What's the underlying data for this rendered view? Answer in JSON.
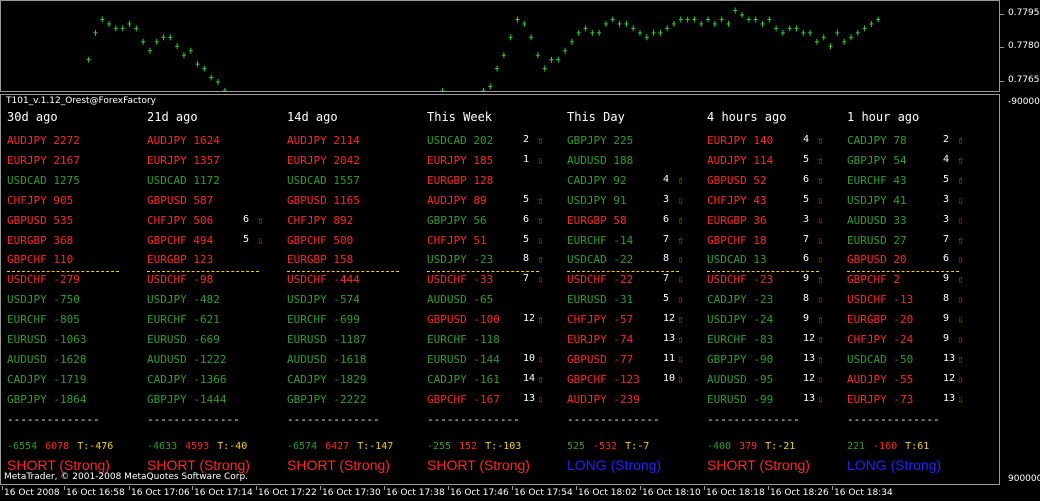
{
  "colors": {
    "short": "#ff2626",
    "long": "#2e9e2e",
    "separator": "#f2d400",
    "long_verdict": "#2020ff",
    "candle": "#2bd02b"
  },
  "price_axis": [
    "0.7795",
    "0.7780",
    "0.7765"
  ],
  "indicator_axis": [
    "-900000",
    "9000000"
  ],
  "indicator_title": "T101_v.1.12_Orest@ForexFactory",
  "footer": "MetaTrader, © 2001-2008 MetaQuotes Software Corp.",
  "time_axis": [
    "16 Oct 2008",
    "16 Oct 16:58",
    "16 Oct 17:06",
    "16 Oct 17:14",
    "16 Oct 17:22",
    "16 Oct 17:30",
    "16 Oct 17:38",
    "16 Oct 17:46",
    "16 Oct 17:54",
    "16 Oct 18:02",
    "16 Oct 18:10",
    "16 Oct 18:18",
    "16 Oct 18:26",
    "16 Oct 18:34"
  ],
  "price_series": [
    0.77625,
    0.77645,
    0.7765,
    0.7767,
    0.7768,
    0.7767,
    0.7768,
    0.7768,
    0.777,
    0.7772,
    0.7774,
    0.7776,
    0.7785,
    0.7791,
    0.7794,
    0.7793,
    0.7792,
    0.7792,
    0.7793,
    0.7792,
    0.7789,
    0.7787,
    0.7789,
    0.779,
    0.779,
    0.7788,
    0.7786,
    0.7787,
    0.7784,
    0.7783,
    0.7781,
    0.778,
    0.7778,
    0.7776,
    0.7775,
    0.7774,
    0.7772,
    0.7773,
    0.7771,
    0.7772,
    0.7774,
    0.7775,
    0.7773,
    0.7772,
    0.7771,
    0.7772,
    0.7774,
    0.7776,
    0.7774,
    0.7772,
    0.777,
    0.777,
    0.777,
    0.777,
    0.7771,
    0.777,
    0.7769,
    0.7769,
    0.7769,
    0.7771,
    0.777,
    0.7771,
    0.7772,
    0.7775,
    0.7778,
    0.7776,
    0.7775,
    0.7774,
    0.7775,
    0.7777,
    0.7778,
    0.7779,
    0.7783,
    0.7786,
    0.779,
    0.7794,
    0.7793,
    0.779,
    0.7786,
    0.7783,
    0.7785,
    0.7785,
    0.7787,
    0.7789,
    0.7791,
    0.7792,
    0.7791,
    0.7791,
    0.7793,
    0.7794,
    0.7793,
    0.7793,
    0.7792,
    0.7791,
    0.779,
    0.7791,
    0.7791,
    0.7792,
    0.7793,
    0.7794,
    0.7794,
    0.7794,
    0.7793,
    0.7794,
    0.7793,
    0.7794,
    0.7793,
    0.7796,
    0.7795,
    0.7794,
    0.7794,
    0.7793,
    0.7794,
    0.7792,
    0.7791,
    0.7792,
    0.7792,
    0.7791,
    0.7791,
    0.7789,
    0.779,
    0.7788,
    0.7791,
    0.7789,
    0.779,
    0.7791,
    0.7792,
    0.7793,
    0.7794
  ],
  "columns": [
    {
      "header": "30d ago",
      "rows": [
        {
          "pair": "AUDJPY",
          "value": "2272",
          "color": "red",
          "rank": "",
          "dir": ""
        },
        {
          "pair": "EURJPY",
          "value": "2167",
          "color": "red",
          "rank": "",
          "dir": ""
        },
        {
          "pair": "USDCAD",
          "value": "1275",
          "color": "green",
          "rank": "",
          "dir": ""
        },
        {
          "pair": "CHFJPY",
          "value": "905",
          "color": "red",
          "rank": "",
          "dir": ""
        },
        {
          "pair": "GBPUSD",
          "value": "535",
          "color": "red",
          "rank": "",
          "dir": ""
        },
        {
          "pair": "EURGBP",
          "value": "368",
          "color": "red",
          "rank": "",
          "dir": ""
        },
        {
          "pair": "GBPCHF",
          "value": "110",
          "color": "red",
          "rank": "",
          "dir": ""
        },
        {
          "pair": "USDCHF",
          "value": "-279",
          "color": "red",
          "rank": "",
          "dir": ""
        },
        {
          "pair": "USDJPY",
          "value": "-750",
          "color": "green",
          "rank": "",
          "dir": ""
        },
        {
          "pair": "EURCHF",
          "value": "-805",
          "color": "green",
          "rank": "",
          "dir": ""
        },
        {
          "pair": "EURUSD",
          "value": "-1063",
          "color": "green",
          "rank": "",
          "dir": ""
        },
        {
          "pair": "AUDUSD",
          "value": "-1628",
          "color": "green",
          "rank": "",
          "dir": ""
        },
        {
          "pair": "CADJPY",
          "value": "-1719",
          "color": "green",
          "rank": "",
          "dir": ""
        },
        {
          "pair": "GBPJPY",
          "value": "-1864",
          "color": "green",
          "rank": "",
          "dir": ""
        }
      ],
      "dashes": "--------------",
      "t1": "-6554",
      "t2": "6078",
      "t3": "T:-476",
      "verdict": "SHORT (Strong)",
      "verdict_color": "red"
    },
    {
      "header": "21d ago",
      "rows": [
        {
          "pair": "AUDJPY",
          "value": "1624",
          "color": "red",
          "rank": "",
          "dir": ""
        },
        {
          "pair": "EURJPY",
          "value": "1357",
          "color": "red",
          "rank": "",
          "dir": ""
        },
        {
          "pair": "USDCAD",
          "value": "1172",
          "color": "green",
          "rank": "",
          "dir": ""
        },
        {
          "pair": "GBPUSD",
          "value": "587",
          "color": "red",
          "rank": "",
          "dir": ""
        },
        {
          "pair": "CHFJPY",
          "value": "506",
          "color": "red",
          "rank": "6",
          "dir": "up"
        },
        {
          "pair": "GBPCHF",
          "value": "494",
          "color": "red",
          "rank": "5",
          "dir": "down"
        },
        {
          "pair": "EURGBP",
          "value": "123",
          "color": "red",
          "rank": "",
          "dir": ""
        },
        {
          "pair": "USDCHF",
          "value": "-98",
          "color": "red",
          "rank": "",
          "dir": ""
        },
        {
          "pair": "USDJPY",
          "value": "-482",
          "color": "green",
          "rank": "",
          "dir": ""
        },
        {
          "pair": "EURCHF",
          "value": "-621",
          "color": "green",
          "rank": "",
          "dir": ""
        },
        {
          "pair": "EURUSD",
          "value": "-669",
          "color": "green",
          "rank": "",
          "dir": ""
        },
        {
          "pair": "AUDUSD",
          "value": "-1222",
          "color": "green",
          "rank": "",
          "dir": ""
        },
        {
          "pair": "CADJPY",
          "value": "-1366",
          "color": "green",
          "rank": "",
          "dir": ""
        },
        {
          "pair": "GBPJPY",
          "value": "-1444",
          "color": "green",
          "rank": "",
          "dir": ""
        }
      ],
      "dashes": "--------------",
      "t1": "-4633",
      "t2": "4593",
      "t3": "T:-40",
      "verdict": "SHORT (Strong)",
      "verdict_color": "red"
    },
    {
      "header": "14d ago",
      "rows": [
        {
          "pair": "AUDJPY",
          "value": "2114",
          "color": "red",
          "rank": "",
          "dir": ""
        },
        {
          "pair": "EURJPY",
          "value": "2042",
          "color": "red",
          "rank": "",
          "dir": ""
        },
        {
          "pair": "USDCAD",
          "value": "1557",
          "color": "green",
          "rank": "",
          "dir": ""
        },
        {
          "pair": "GBPUSD",
          "value": "1165",
          "color": "red",
          "rank": "",
          "dir": ""
        },
        {
          "pair": "CHFJPY",
          "value": "892",
          "color": "red",
          "rank": "",
          "dir": ""
        },
        {
          "pair": "GBPCHF",
          "value": "500",
          "color": "red",
          "rank": "",
          "dir": ""
        },
        {
          "pair": "EURGBP",
          "value": "158",
          "color": "red",
          "rank": "",
          "dir": ""
        },
        {
          "pair": "USDCHF",
          "value": "-444",
          "color": "red",
          "rank": "",
          "dir": ""
        },
        {
          "pair": "USDJPY",
          "value": "-574",
          "color": "green",
          "rank": "",
          "dir": ""
        },
        {
          "pair": "EURCHF",
          "value": "-699",
          "color": "green",
          "rank": "",
          "dir": ""
        },
        {
          "pair": "EURUSD",
          "value": "-1187",
          "color": "green",
          "rank": "",
          "dir": ""
        },
        {
          "pair": "AUDUSD",
          "value": "-1618",
          "color": "green",
          "rank": "",
          "dir": ""
        },
        {
          "pair": "CADJPY",
          "value": "-1829",
          "color": "green",
          "rank": "",
          "dir": ""
        },
        {
          "pair": "GBPJPY",
          "value": "-2222",
          "color": "green",
          "rank": "",
          "dir": ""
        }
      ],
      "dashes": "--------------",
      "t1": "-6574",
      "t2": "6427",
      "t3": "T:-147",
      "verdict": "SHORT (Strong)",
      "verdict_color": "red"
    },
    {
      "header": "This Week",
      "rows": [
        {
          "pair": "USDCAD",
          "value": "202",
          "color": "green",
          "rank": "2",
          "dir": "up"
        },
        {
          "pair": "EURJPY",
          "value": "185",
          "color": "red",
          "rank": "1",
          "dir": "down"
        },
        {
          "pair": "EURGBP",
          "value": "128",
          "color": "red",
          "rank": "",
          "dir": ""
        },
        {
          "pair": "AUDJPY",
          "value": "89",
          "color": "red",
          "rank": "5",
          "dir": "up"
        },
        {
          "pair": "GBPJPY",
          "value": "56",
          "color": "green",
          "rank": "6",
          "dir": "up"
        },
        {
          "pair": "CHFJPY",
          "value": "51",
          "color": "red",
          "rank": "5",
          "dir": "down"
        },
        {
          "pair": "USDJPY",
          "value": "-23",
          "color": "green",
          "rank": "8",
          "dir": "up"
        },
        {
          "pair": "USDCHF",
          "value": "-33",
          "color": "red",
          "rank": "7",
          "dir": "down"
        },
        {
          "pair": "AUDUSD",
          "value": "-65",
          "color": "green",
          "rank": "",
          "dir": ""
        },
        {
          "pair": "GBPUSD",
          "value": "-100",
          "color": "red",
          "rank": "12",
          "dir": "up"
        },
        {
          "pair": "EURCHF",
          "value": "-118",
          "color": "green",
          "rank": "",
          "dir": ""
        },
        {
          "pair": "EURUSD",
          "value": "-144",
          "color": "green",
          "rank": "10",
          "dir": "down"
        },
        {
          "pair": "CADJPY",
          "value": "-161",
          "color": "green",
          "rank": "14",
          "dir": "up"
        },
        {
          "pair": "GBPCHF",
          "value": "-167",
          "color": "red",
          "rank": "13",
          "dir": "down"
        }
      ],
      "dashes": "--------------",
      "t1": "-255",
      "t2": "152",
      "t3": "T:-103",
      "verdict": "SHORT (Strong)",
      "verdict_color": "red"
    },
    {
      "header": "This Day",
      "rows": [
        {
          "pair": "GBPJPY",
          "value": "225",
          "color": "green",
          "rank": "",
          "dir": ""
        },
        {
          "pair": "AUDUSD",
          "value": "188",
          "color": "green",
          "rank": "",
          "dir": ""
        },
        {
          "pair": "CADJPY",
          "value": "92",
          "color": "green",
          "rank": "4",
          "dir": "up"
        },
        {
          "pair": "USDJPY",
          "value": "91",
          "color": "green",
          "rank": "3",
          "dir": "down"
        },
        {
          "pair": "EURGBP",
          "value": "58",
          "color": "red",
          "rank": "6",
          "dir": "up"
        },
        {
          "pair": "EURCHF",
          "value": "-14",
          "color": "green",
          "rank": "7",
          "dir": "up"
        },
        {
          "pair": "USDCAD",
          "value": "-22",
          "color": "green",
          "rank": "8",
          "dir": "up"
        },
        {
          "pair": "USDCHF",
          "value": "-22",
          "color": "red",
          "rank": "7",
          "dir": "down"
        },
        {
          "pair": "EURUSD",
          "value": "-31",
          "color": "green",
          "rank": "5",
          "dir": "down"
        },
        {
          "pair": "CHFJPY",
          "value": "-57",
          "color": "red",
          "rank": "12",
          "dir": "up"
        },
        {
          "pair": "EURJPY",
          "value": "-74",
          "color": "red",
          "rank": "13",
          "dir": "up"
        },
        {
          "pair": "GBPUSD",
          "value": "-77",
          "color": "red",
          "rank": "11",
          "dir": "down"
        },
        {
          "pair": "GBPCHF",
          "value": "-123",
          "color": "red",
          "rank": "10",
          "dir": "down"
        },
        {
          "pair": "AUDJPY",
          "value": "-239",
          "color": "red",
          "rank": "",
          "dir": ""
        }
      ],
      "dashes": "--------------",
      "t1": "525",
      "t2": "-532",
      "t3": "T:-7",
      "verdict": "LONG (Strong)",
      "verdict_color": "blue"
    },
    {
      "header": "4 hours ago",
      "rows": [
        {
          "pair": "EURJPY",
          "value": "140",
          "color": "red",
          "rank": "4",
          "dir": "up"
        },
        {
          "pair": "AUDJPY",
          "value": "114",
          "color": "red",
          "rank": "5",
          "dir": "up"
        },
        {
          "pair": "GBPUSD",
          "value": "52",
          "color": "red",
          "rank": "6",
          "dir": "up"
        },
        {
          "pair": "CHFJPY",
          "value": "43",
          "color": "red",
          "rank": "5",
          "dir": "down"
        },
        {
          "pair": "EURGBP",
          "value": "36",
          "color": "red",
          "rank": "3",
          "dir": "down"
        },
        {
          "pair": "GBPCHF",
          "value": "18",
          "color": "red",
          "rank": "7",
          "dir": "down"
        },
        {
          "pair": "USDCAD",
          "value": "13",
          "color": "green",
          "rank": "6",
          "dir": "down"
        },
        {
          "pair": "USDCHF",
          "value": "-23",
          "color": "red",
          "rank": "9",
          "dir": "up"
        },
        {
          "pair": "CADJPY",
          "value": "-23",
          "color": "green",
          "rank": "8",
          "dir": "down"
        },
        {
          "pair": "USDJPY",
          "value": "-24",
          "color": "green",
          "rank": "9",
          "dir": "up"
        },
        {
          "pair": "EURCHF",
          "value": "-83",
          "color": "green",
          "rank": "12",
          "dir": "up"
        },
        {
          "pair": "GBPJPY",
          "value": "-90",
          "color": "green",
          "rank": "13",
          "dir": "up"
        },
        {
          "pair": "AUDUSD",
          "value": "-95",
          "color": "green",
          "rank": "12",
          "dir": "down"
        },
        {
          "pair": "EURUSD",
          "value": "-99",
          "color": "green",
          "rank": "13",
          "dir": "down"
        }
      ],
      "dashes": "--------------",
      "t1": "-400",
      "t2": "379",
      "t3": "T:-21",
      "verdict": "SHORT (Strong)",
      "verdict_color": "red"
    },
    {
      "header": "1 hour ago",
      "rows": [
        {
          "pair": "CADJPY",
          "value": "78",
          "color": "green",
          "rank": "2",
          "dir": "up"
        },
        {
          "pair": "GBPJPY",
          "value": "54",
          "color": "green",
          "rank": "4",
          "dir": "up"
        },
        {
          "pair": "EURCHF",
          "value": "43",
          "color": "green",
          "rank": "5",
          "dir": "up"
        },
        {
          "pair": "USDJPY",
          "value": "41",
          "color": "green",
          "rank": "3",
          "dir": "down"
        },
        {
          "pair": "AUDUSD",
          "value": "33",
          "color": "green",
          "rank": "3",
          "dir": "down"
        },
        {
          "pair": "EURUSD",
          "value": "27",
          "color": "green",
          "rank": "7",
          "dir": "up"
        },
        {
          "pair": "GBPUSD",
          "value": "20",
          "color": "red",
          "rank": "6",
          "dir": "down"
        },
        {
          "pair": "GBPCHF",
          "value": "2",
          "color": "red",
          "rank": "9",
          "dir": "up"
        },
        {
          "pair": "USDCHF",
          "value": "-13",
          "color": "red",
          "rank": "8",
          "dir": "down"
        },
        {
          "pair": "EURGBP",
          "value": "-20",
          "color": "red",
          "rank": "9",
          "dir": "down"
        },
        {
          "pair": "CHFJPY",
          "value": "-24",
          "color": "red",
          "rank": "9",
          "dir": "down"
        },
        {
          "pair": "USDCAD",
          "value": "-50",
          "color": "green",
          "rank": "13",
          "dir": "up"
        },
        {
          "pair": "AUDJPY",
          "value": "-55",
          "color": "red",
          "rank": "12",
          "dir": "down"
        },
        {
          "pair": "EURJPY",
          "value": "-73",
          "color": "red",
          "rank": "13",
          "dir": "down"
        }
      ],
      "dashes": "--------------",
      "t1": "221",
      "t2": "-160",
      "t3": "T:61",
      "verdict": "LONG (Strong)",
      "verdict_color": "blue"
    }
  ]
}
